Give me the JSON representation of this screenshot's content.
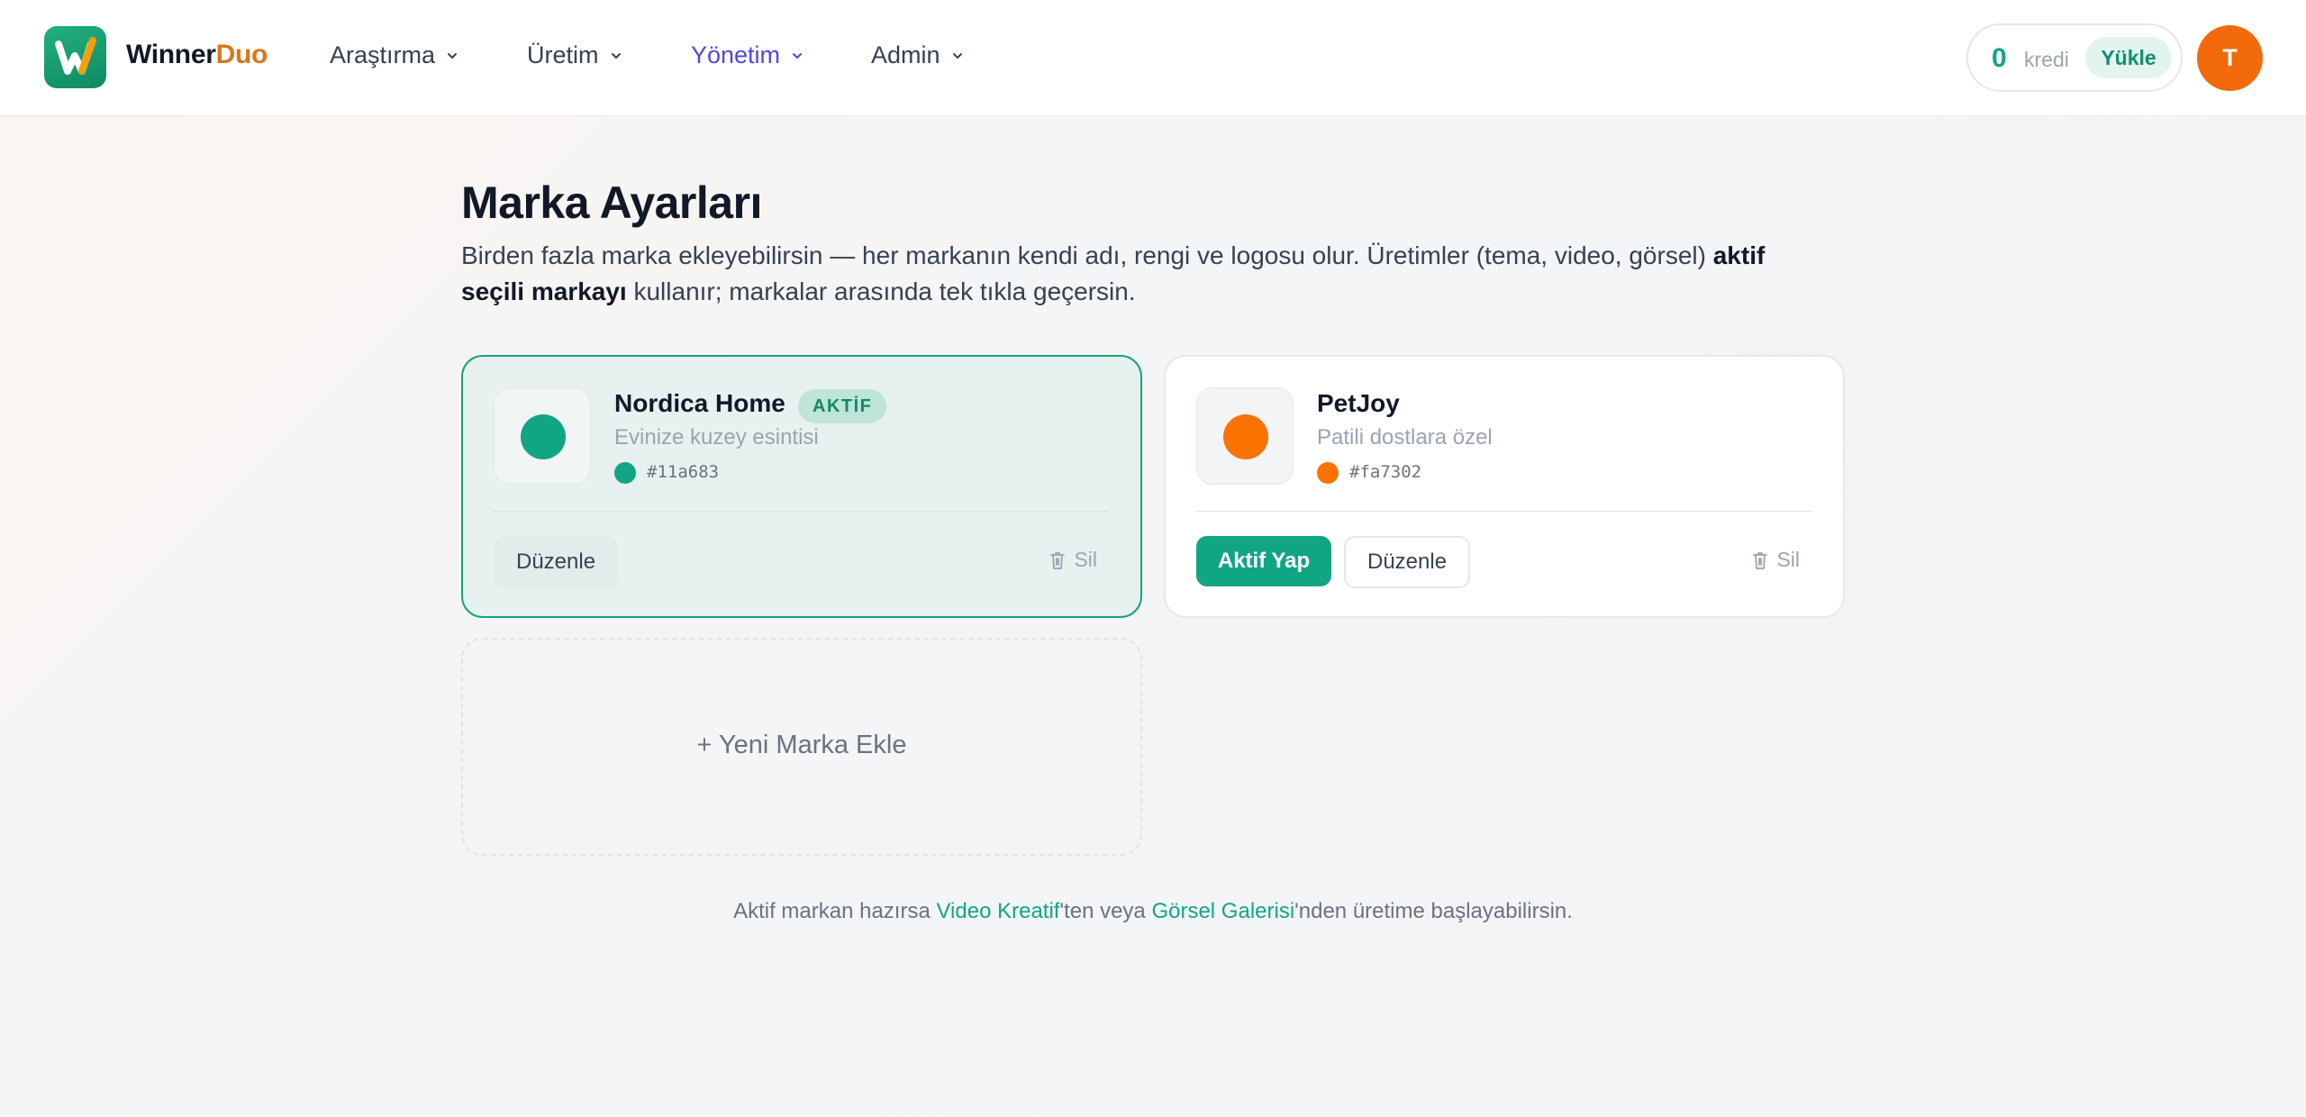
{
  "header": {
    "brand_part1": "Winner",
    "brand_part2": "Duo",
    "nav": [
      {
        "label": "Araştırma"
      },
      {
        "label": "Üretim"
      },
      {
        "label": "Yönetim"
      },
      {
        "label": "Admin"
      }
    ],
    "active_nav": "Yönetim",
    "credits": {
      "value": "0",
      "label": "kredi",
      "load_label": "Yükle"
    },
    "avatar_initial": "T"
  },
  "page": {
    "title": "Marka Ayarları",
    "intro_part1": "Birden fazla marka ekleyebilirsin — her markanın kendi adı, rengi ve logosu olur. Üretimler (tema, video, görsel) ",
    "intro_bold": "aktif seçili markayı",
    "intro_part2": " kullanır; markalar arasında tek tıkla geçersin."
  },
  "brands": [
    {
      "name": "Nordica Home",
      "tagline": "Evinize kuzey esintisi",
      "color": "#11a683",
      "hex_label": "#11a683",
      "active": true,
      "badge": "AKTİF",
      "edit_label": "Düzenle",
      "delete_label": "Sil"
    },
    {
      "name": "PetJoy",
      "tagline": "Patili dostlara özel",
      "color": "#fa7302",
      "hex_label": "#fa7302",
      "active": false,
      "activate_label": "Aktif Yap",
      "edit_label": "Düzenle",
      "delete_label": "Sil"
    }
  ],
  "add_brand_label": "+ Yeni Marka Ekle",
  "footer": {
    "part1": "Aktif markan hazırsa ",
    "link1": "Video Kreatif",
    "part2": "'ten veya ",
    "link2": "Görsel Galerisi",
    "part3": "'nden üretime başlayabilirsin."
  },
  "colors": {
    "accent": "#11a683",
    "nav_active": "#4f46e5",
    "brand_orange": "#d9761a",
    "avatar": "#f26a0c"
  }
}
